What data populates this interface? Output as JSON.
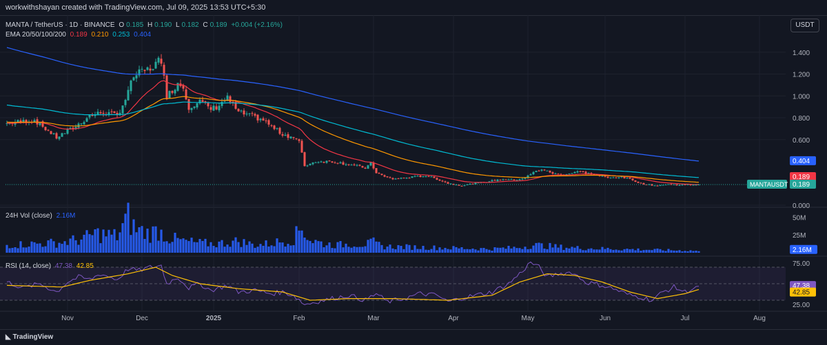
{
  "header": {
    "text": "workwithshayan created with TradingView.com, Jul 09, 2025 13:53 UTC+5:30"
  },
  "main_legend": {
    "symbol": "MANTA / TetherUS · 1D · BINANCE",
    "o_label": "O",
    "o": "0.185",
    "h_label": "H",
    "h": "0.190",
    "l_label": "L",
    "l": "0.182",
    "c_label": "C",
    "c": "0.189",
    "change": "+0.004 (+2.16%)"
  },
  "ema_legend": {
    "label": "EMA 20/50/100/200",
    "v20": "0.189",
    "v50": "0.210",
    "v100": "0.253",
    "v200": "0.404"
  },
  "vol_legend": {
    "label": "24H Vol (close)",
    "value": "2.16M"
  },
  "rsi_legend": {
    "label": "RSI (14, close)",
    "rsi": "47.38",
    "ma": "42.85"
  },
  "currency_button": "USDT",
  "footer": {
    "logo": "TradingView"
  },
  "colors": {
    "up": "#26a69a",
    "down": "#ef5350",
    "ema20": "#f23645",
    "ema50": "#ff9800",
    "ema100": "#00bcd4",
    "ema200": "#2962ff",
    "rsi": "#7e57c2",
    "rsi_ma": "#ffc107",
    "vol": "#2962ff",
    "bg": "#131722"
  },
  "chart_data": [
    {
      "type": "candlestick",
      "title": "MANTA / TetherUS · 1D · BINANCE",
      "x_ticks": [
        "Nov",
        "Dec",
        "2025",
        "Feb",
        "Mar",
        "Apr",
        "May",
        "Jun",
        "Jul",
        "Aug"
      ],
      "x_tick_index": [
        22,
        49,
        75,
        106,
        133,
        162,
        189,
        217,
        246,
        273
      ],
      "y_ticks": [
        "1.400",
        "1.200",
        "1.000",
        "0.800",
        "0.600",
        "0.000"
      ],
      "y_tick_values": [
        1.4,
        1.2,
        1.0,
        0.8,
        0.6,
        0.0
      ],
      "ylim": [
        0,
        1.55
      ],
      "last_price_label": "MANTAUSDT",
      "last_price": "0.189",
      "close_anchors": [
        [
          0,
          0.75
        ],
        [
          10,
          0.78
        ],
        [
          18,
          0.62
        ],
        [
          25,
          0.72
        ],
        [
          30,
          0.82
        ],
        [
          35,
          0.85
        ],
        [
          40,
          0.82
        ],
        [
          43,
          0.97
        ],
        [
          46,
          1.18
        ],
        [
          49,
          1.22
        ],
        [
          52,
          1.25
        ],
        [
          55,
          1.32
        ],
        [
          57,
          1.22
        ],
        [
          58,
          1.0
        ],
        [
          60,
          1.05
        ],
        [
          62,
          1.12
        ],
        [
          64,
          1.08
        ],
        [
          66,
          0.9
        ],
        [
          70,
          0.95
        ],
        [
          74,
          0.88
        ],
        [
          76,
          0.9
        ],
        [
          80,
          0.98
        ],
        [
          84,
          0.85
        ],
        [
          88,
          0.82
        ],
        [
          93,
          0.78
        ],
        [
          96,
          0.72
        ],
        [
          100,
          0.65
        ],
        [
          104,
          0.62
        ],
        [
          106,
          0.58
        ],
        [
          108,
          0.36
        ],
        [
          112,
          0.4
        ],
        [
          118,
          0.4
        ],
        [
          125,
          0.37
        ],
        [
          130,
          0.34
        ],
        [
          132,
          0.38
        ],
        [
          134,
          0.3
        ],
        [
          137,
          0.26
        ],
        [
          140,
          0.24
        ],
        [
          148,
          0.26
        ],
        [
          152,
          0.27
        ],
        [
          156,
          0.24
        ],
        [
          160,
          0.2
        ],
        [
          165,
          0.18
        ],
        [
          170,
          0.2
        ],
        [
          175,
          0.22
        ],
        [
          180,
          0.24
        ],
        [
          184,
          0.23
        ],
        [
          188,
          0.25
        ],
        [
          191,
          0.3
        ],
        [
          194,
          0.33
        ],
        [
          197,
          0.3
        ],
        [
          200,
          0.28
        ],
        [
          204,
          0.29
        ],
        [
          207,
          0.31
        ],
        [
          211,
          0.29
        ],
        [
          215,
          0.27
        ],
        [
          218,
          0.25
        ],
        [
          222,
          0.26
        ],
        [
          226,
          0.24
        ],
        [
          230,
          0.2
        ],
        [
          235,
          0.18
        ],
        [
          240,
          0.19
        ],
        [
          245,
          0.185
        ],
        [
          251,
          0.189
        ]
      ],
      "ema20": "0.189",
      "ema50": "0.210",
      "ema100": "0.253",
      "ema200": "0.404"
    },
    {
      "type": "bar",
      "title": "24H Vol (close)",
      "y_ticks": [
        "50M",
        "25M"
      ],
      "y_tick_values": [
        50,
        25
      ],
      "unit": "M",
      "last_value": "2.16M",
      "ylim": [
        0,
        60
      ],
      "volume_anchors": [
        [
          0,
          12
        ],
        [
          10,
          14
        ],
        [
          20,
          16
        ],
        [
          28,
          22
        ],
        [
          32,
          30
        ],
        [
          36,
          28
        ],
        [
          40,
          26
        ],
        [
          44,
          55
        ],
        [
          46,
          40
        ],
        [
          48,
          35
        ],
        [
          50,
          32
        ],
        [
          52,
          30
        ],
        [
          55,
          35
        ],
        [
          58,
          25
        ],
        [
          60,
          22
        ],
        [
          64,
          18
        ],
        [
          70,
          15
        ],
        [
          76,
          14
        ],
        [
          80,
          16
        ],
        [
          84,
          18
        ],
        [
          90,
          12
        ],
        [
          95,
          14
        ],
        [
          100,
          18
        ],
        [
          104,
          22
        ],
        [
          107,
          40
        ],
        [
          110,
          20
        ],
        [
          115,
          14
        ],
        [
          120,
          12
        ],
        [
          125,
          14
        ],
        [
          130,
          13
        ],
        [
          133,
          16
        ],
        [
          136,
          10
        ],
        [
          145,
          9
        ],
        [
          155,
          8
        ],
        [
          165,
          7
        ],
        [
          175,
          6
        ],
        [
          185,
          8
        ],
        [
          191,
          12
        ],
        [
          195,
          11
        ],
        [
          200,
          9
        ],
        [
          205,
          8
        ],
        [
          210,
          7
        ],
        [
          220,
          6
        ],
        [
          230,
          5
        ],
        [
          240,
          4
        ],
        [
          251,
          3
        ]
      ]
    },
    {
      "type": "line",
      "title": "RSI (14, close)",
      "y_ticks": [
        "75.00",
        "25.00"
      ],
      "y_tick_values": [
        75,
        25
      ],
      "ylim": [
        20,
        80
      ],
      "band": [
        30,
        70
      ],
      "rsi_last": "47.38",
      "ma_last": "42.85",
      "rsi_anchors": [
        [
          0,
          52
        ],
        [
          6,
          45
        ],
        [
          12,
          50
        ],
        [
          18,
          40
        ],
        [
          22,
          52
        ],
        [
          26,
          58
        ],
        [
          30,
          55
        ],
        [
          34,
          62
        ],
        [
          40,
          55
        ],
        [
          44,
          68
        ],
        [
          48,
          66
        ],
        [
          52,
          70
        ],
        [
          56,
          72
        ],
        [
          58,
          50
        ],
        [
          62,
          58
        ],
        [
          66,
          45
        ],
        [
          70,
          50
        ],
        [
          74,
          42
        ],
        [
          80,
          48
        ],
        [
          84,
          40
        ],
        [
          90,
          42
        ],
        [
          96,
          38
        ],
        [
          100,
          40
        ],
        [
          104,
          36
        ],
        [
          108,
          25
        ],
        [
          112,
          28
        ],
        [
          118,
          32
        ],
        [
          124,
          36
        ],
        [
          130,
          30
        ],
        [
          134,
          38
        ],
        [
          138,
          28
        ],
        [
          144,
          32
        ],
        [
          150,
          38
        ],
        [
          156,
          36
        ],
        [
          160,
          28
        ],
        [
          164,
          32
        ],
        [
          170,
          36
        ],
        [
          176,
          40
        ],
        [
          182,
          50
        ],
        [
          186,
          62
        ],
        [
          190,
          76
        ],
        [
          193,
          70
        ],
        [
          196,
          58
        ],
        [
          200,
          62
        ],
        [
          205,
          64
        ],
        [
          210,
          52
        ],
        [
          216,
          48
        ],
        [
          220,
          44
        ],
        [
          226,
          36
        ],
        [
          230,
          34
        ],
        [
          234,
          30
        ],
        [
          238,
          40
        ],
        [
          242,
          46
        ],
        [
          246,
          40
        ],
        [
          251,
          47
        ]
      ],
      "ma_anchors": [
        [
          0,
          48
        ],
        [
          20,
          46
        ],
        [
          30,
          54
        ],
        [
          44,
          62
        ],
        [
          54,
          70
        ],
        [
          60,
          60
        ],
        [
          70,
          50
        ],
        [
          84,
          44
        ],
        [
          100,
          40
        ],
        [
          110,
          30
        ],
        [
          124,
          32
        ],
        [
          140,
          32
        ],
        [
          160,
          30
        ],
        [
          176,
          36
        ],
        [
          186,
          52
        ],
        [
          196,
          62
        ],
        [
          206,
          60
        ],
        [
          216,
          52
        ],
        [
          226,
          40
        ],
        [
          236,
          32
        ],
        [
          246,
          38
        ],
        [
          251,
          43
        ]
      ]
    }
  ]
}
